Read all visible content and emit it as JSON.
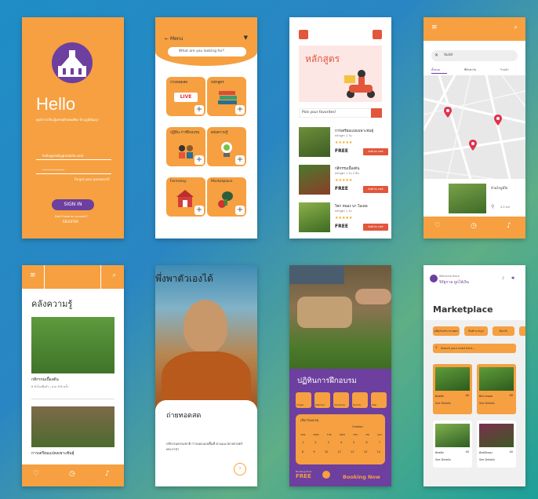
{
  "colors": {
    "accent": "#f6a041",
    "brand_purple": "#6d3f9f",
    "red": "#e2563b"
  },
  "login": {
    "title": "Hello",
    "subtitle": "ศูนย์การเรียนรู้เศรษฐกิจพอเพียง บ้านภูมิปัญญา",
    "email": "hello@reallygreatsite.com",
    "password": "••••••••••••",
    "forgot": "Forgot your password?",
    "sign_in": "SIGN IN",
    "no_account": "Don't have an account?",
    "register": "REGISTER"
  },
  "menu": {
    "back_label": "Menu",
    "search_placeholder": "What are you looking for?",
    "tiles": [
      {
        "label": "ถ่ายทอดสด",
        "badge": "LIVE"
      },
      {
        "label": "หลักสูตร"
      },
      {
        "label": "ปฏิทิน การฝึกอบรม"
      },
      {
        "label": "คลังความรู้"
      },
      {
        "label": "Farmstay"
      },
      {
        "label": "Marketplace"
      }
    ]
  },
  "courses": {
    "hero_title": "หลักสูตร",
    "pick_placeholder": "Pick your favorites!",
    "items": [
      {
        "name": "การเตรียมแปลงเพาะพันธุ์",
        "meta": "หลักสูตร 1 วัน",
        "stars": "★★★★★",
        "price": "FREE",
        "add": "Add to cart"
      },
      {
        "name": "กสิกรรมเบื้องต้น",
        "meta": "หลักสูตร 1 วัน 2 คืน",
        "stars": "★★★★★",
        "price": "FREE",
        "add": "Add to cart"
      },
      {
        "name": "โคก หนอง นา โมเดล",
        "meta": "หลักสูตร 1 วัน",
        "stars": "★★★★★",
        "price": "FREE",
        "add": "Add to cart"
      }
    ]
  },
  "map": {
    "search_value": "Vuldr",
    "tabs": [
      "ทั้งหมด",
      "ที่พักฟาร์ม",
      "ร้านค้า"
    ],
    "card_title": "บ้านไร่ภูมิใจ",
    "card_meta": "4.5 km"
  },
  "knowledge": {
    "title": "คลังความรู้",
    "article1_title": "กสิกรรมเบื้องต้น",
    "article1_meta": "8 ชั่วโมงที่แล้ว | อ่าน 355 ครั้ง",
    "article2_title": "การเตรียมแปลงเพาะพันธุ์"
  },
  "live": {
    "banner_text": "พึ่งพาตัวเองได้",
    "title": "ถ่ายทอดสด",
    "desc": "กสิกรรมธรรมชาติ การออกแบบพื้นที่ ตามแนวทางศาสตร์พระราชา"
  },
  "training": {
    "title": "ปฏิทินการฝึกอบรม",
    "icons": [
      "Single",
      "Member",
      "Schedule",
      "Rooms",
      "Map"
    ],
    "cal_title": "เลือกวันอบรม",
    "cal_month": "October",
    "cal_days": [
      "SUN",
      "MON",
      "TUE",
      "WED",
      "THU",
      "FRI",
      "SAT"
    ],
    "cal_row1": [
      "1",
      "2",
      "3",
      "4",
      "5",
      "6",
      "7"
    ],
    "cal_row2": [
      "8",
      "9",
      "10",
      "11",
      "12",
      "13",
      "14"
    ],
    "booking_price_label": "Booking Price",
    "price": "FREE",
    "book_now": "Booking Now"
  },
  "market": {
    "welcome": "Welcome Back,",
    "username": "จิรัฐกาล ยูถไธ๋เงิน",
    "title": "Marketplace",
    "chips": [
      "ผลิตภัณฑ์การเกษตร",
      "สินค้าแปรรูป",
      "ต้นกล้า"
    ],
    "search_placeholder": "Search your need here...",
    "products": [
      {
        "name": "ผักสลัด",
        "price": "40",
        "details": "See Details"
      },
      {
        "name": "ผักกาดหอม",
        "price": "40",
        "details": "See Details"
      },
      {
        "name": "ผักสลัด",
        "price": "40",
        "details": "See Details"
      },
      {
        "name": "ผักสลัดแดง",
        "price": "40",
        "details": "See Details"
      }
    ]
  }
}
